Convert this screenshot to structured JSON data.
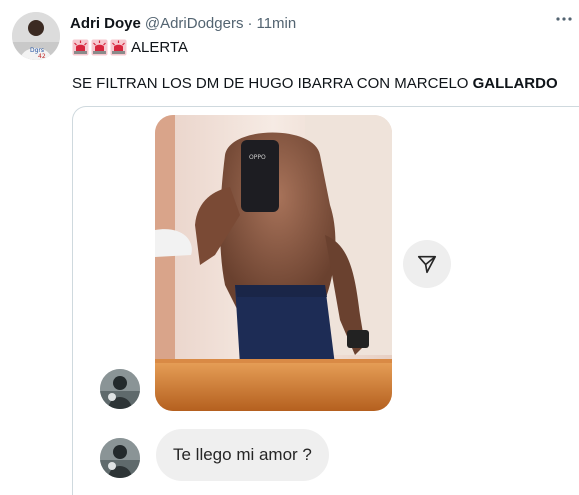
{
  "tweet": {
    "author": {
      "display_name": "Adri Doye",
      "handle": "@AdriDodgers",
      "time": "11min",
      "avatar_icon": "avatar-photo"
    },
    "alert_text": "ALERTA",
    "alert_emoji_icon": "police-light-icon",
    "body_prefix": "SE FILTRAN LOS DM DE HUGO IBARRA CON MARCELO ",
    "body_bold": "GALLARDO",
    "more_icon": "more-icon"
  },
  "media": {
    "share_icon": "send-icon",
    "message_text": "Te llego mi amor ?",
    "bubble_color": "#efefef",
    "accent_dark": "#0f1419"
  }
}
